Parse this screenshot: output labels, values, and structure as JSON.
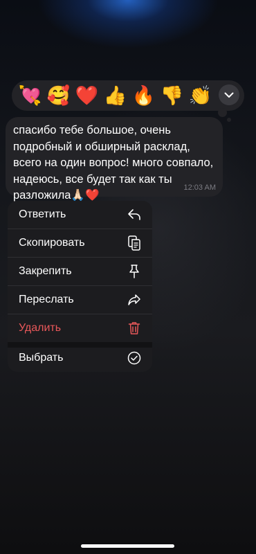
{
  "reactions": [
    {
      "emoji": "💘",
      "name": "heart-with-arrow"
    },
    {
      "emoji": "🥰",
      "name": "smiling-face-with-hearts"
    },
    {
      "emoji": "❤️",
      "name": "red-heart"
    },
    {
      "emoji": "👍",
      "name": "thumbs-up"
    },
    {
      "emoji": "🔥",
      "name": "fire"
    },
    {
      "emoji": "👎",
      "name": "thumbs-down"
    },
    {
      "emoji": "👏",
      "name": "clapping-hands"
    }
  ],
  "expand_icon": "chevron-down-icon",
  "message": {
    "text": "спасибо тебе большое, очень подробный и обширный расклад, всего на один вопрос! много совпало, надеюсь, все будет так как ты разложила🙏🏻❤️",
    "time": "12:03 AM"
  },
  "menu": {
    "reply": "Ответить",
    "copy": "Скопировать",
    "pin": "Закрепить",
    "forward": "Переслать",
    "delete": "Удалить",
    "select": "Выбрать"
  },
  "colors": {
    "bubble": "#232327",
    "menu": "#1c1c1f",
    "danger": "#e9585a"
  }
}
